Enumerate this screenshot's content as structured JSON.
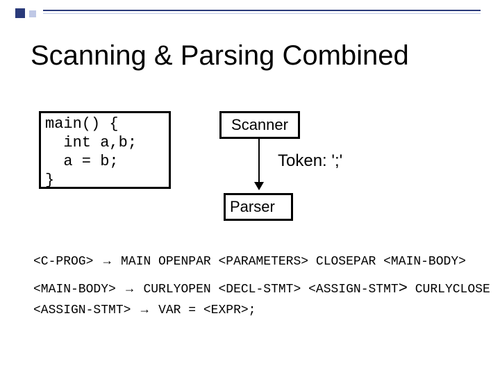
{
  "title": "Scanning & Parsing Combined",
  "code": {
    "l1": "main() {",
    "l2": "  int a,b;",
    "l3": "  a = b;",
    "l4": "}"
  },
  "scanner_label": "Scanner",
  "token": {
    "prefix": "Token: ",
    "value": "';'"
  },
  "parser_label": "Parser",
  "grammar": {
    "arrow": "→",
    "rule1": {
      "lhs": "<C-PROG>",
      "rhs": "MAIN OPENPAR <PARAMETERS> CLOSEPAR <MAIN-BODY>"
    },
    "rule2": {
      "lhs": "<MAIN-BODY>",
      "rhs_a": "CURLYOPEN <DECL-STMT> <ASSIGN-STMT",
      "rhs_b": "CURLYCLOSE",
      "close_angle": ">"
    },
    "rule3": {
      "lhs": "<ASSIGN-STMT>",
      "rhs": "VAR = <EXPR>;"
    }
  }
}
